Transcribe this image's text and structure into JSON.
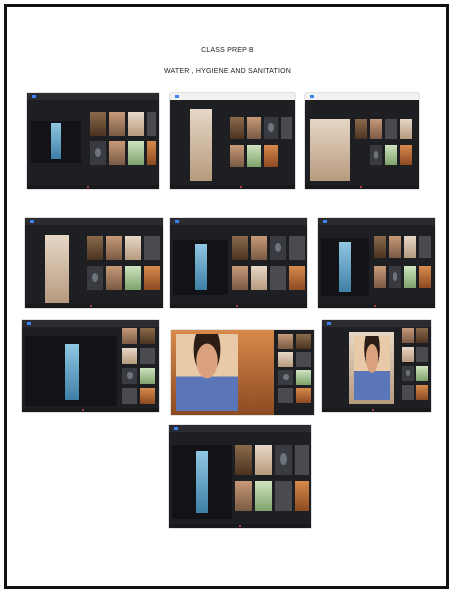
{
  "document": {
    "class_title": "CLASS PREP B",
    "topic_title": "WATER , HYGIENE  AND SANITATION"
  },
  "screenshots": [
    {
      "id": "r1c1",
      "app_bar": "dark"
    },
    {
      "id": "r1c2",
      "app_bar": "light"
    },
    {
      "id": "r1c3",
      "app_bar": "light"
    },
    {
      "id": "r2c1",
      "app_bar": "dark"
    },
    {
      "id": "r2c2",
      "app_bar": "dark"
    },
    {
      "id": "r2c3",
      "app_bar": "dark"
    },
    {
      "id": "r3c1",
      "app_bar": "dark"
    },
    {
      "id": "r3c2",
      "app_bar": "dark"
    },
    {
      "id": "r3c3",
      "app_bar": "dark"
    },
    {
      "id": "r4c1",
      "app_bar": "dark"
    }
  ],
  "colors": {
    "page_background": "#ffffff",
    "meeting_background": "#1e1f22",
    "accent_blue": "#3b82f6",
    "end_call_red": "#e04646"
  }
}
